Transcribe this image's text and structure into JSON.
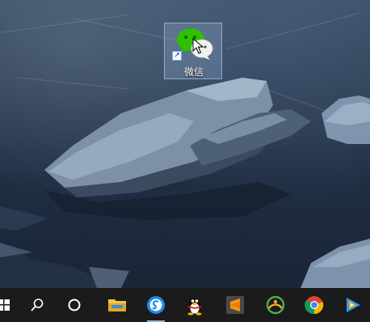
{
  "desktop": {
    "icons": [
      {
        "label": "微信",
        "icon": "wechat-icon",
        "shortcut": true,
        "selected": true
      }
    ]
  },
  "taskbar": {
    "items": [
      {
        "icon": "windows-start-icon"
      },
      {
        "icon": "search-icon"
      },
      {
        "icon": "cortana-circle-icon"
      },
      {
        "icon": "file-explorer-icon"
      },
      {
        "icon": "sogou-browser-icon"
      },
      {
        "icon": "qq-penguin-icon"
      },
      {
        "icon": "sublime-text-icon"
      },
      {
        "icon": "anaconda-navigator-icon"
      },
      {
        "icon": "chrome-icon"
      },
      {
        "icon": "tencent-video-icon"
      }
    ]
  },
  "colors": {
    "wechat_green": "#2dc100",
    "taskbar_bg": "#1b1b1b",
    "selection": "#9cc0e8"
  }
}
